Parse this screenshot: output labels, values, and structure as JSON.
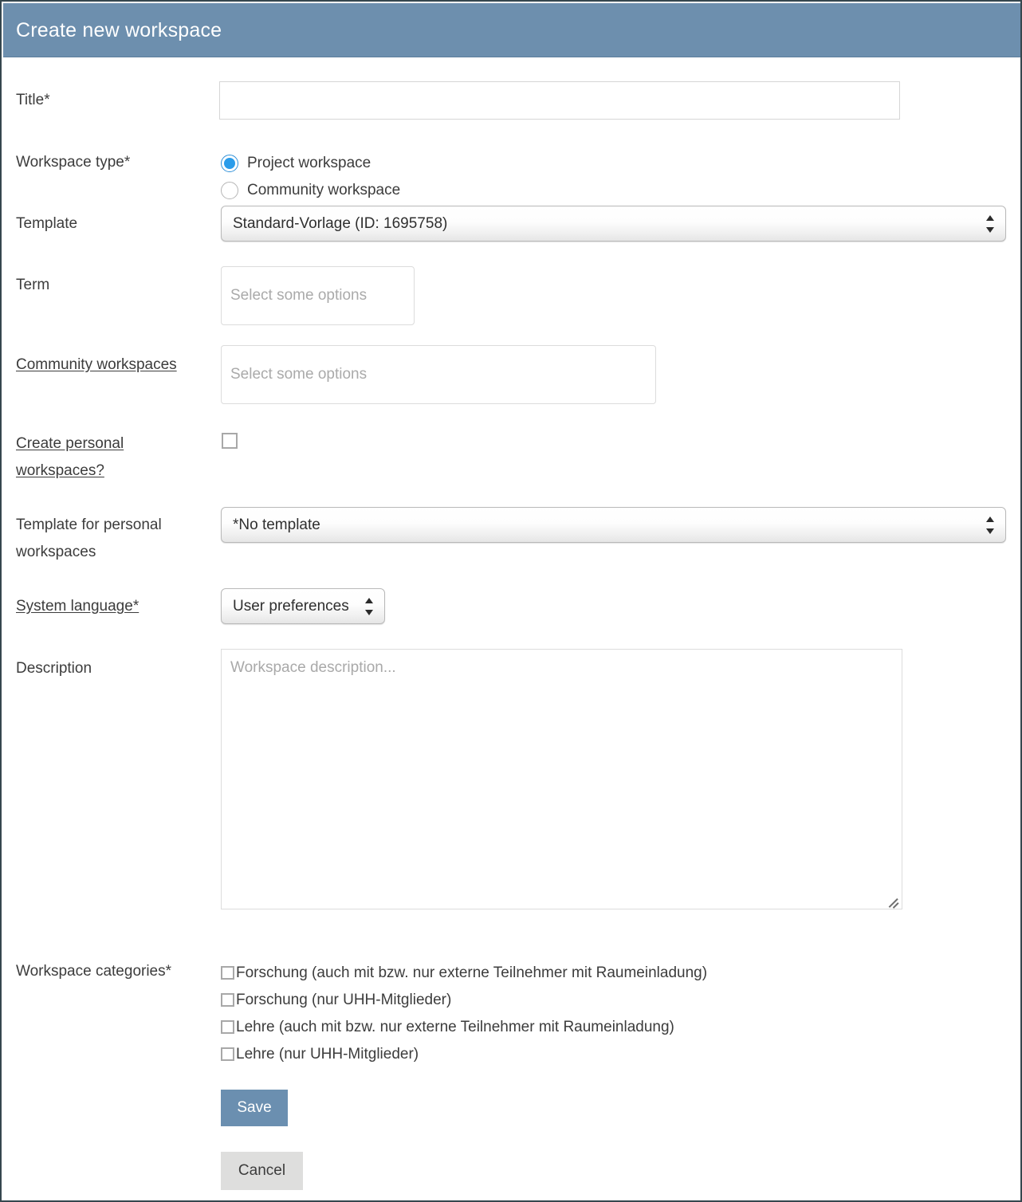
{
  "dialog": {
    "title": "Create new workspace",
    "header_color": "#6d8fae",
    "accent_color": "#6b8fb0"
  },
  "fields": {
    "title": {
      "label": "Title*",
      "value": "",
      "placeholder": ""
    },
    "workspace_type": {
      "label": "Workspace type*",
      "options": [
        {
          "label": "Project workspace",
          "selected": true
        },
        {
          "label": "Community workspace",
          "selected": false
        }
      ]
    },
    "template": {
      "label": "Template",
      "value": "Standard-Vorlage (ID: 1695758)"
    },
    "term": {
      "label": "Term",
      "placeholder": "Select some options",
      "value": ""
    },
    "community_workspaces": {
      "label": "Community workspaces",
      "placeholder": "Select some options",
      "value": ""
    },
    "create_personal_workspaces": {
      "label_line1": "Create personal",
      "label_line2": "workspaces?",
      "checked": false
    },
    "template_personal": {
      "label_line1": "Template for personal",
      "label_line2": "workspaces",
      "value": "*No template"
    },
    "system_language": {
      "label": "System language*",
      "value": "User preferences"
    },
    "description": {
      "label": "Description",
      "placeholder": "Workspace description...",
      "value": ""
    },
    "workspace_categories": {
      "label": "Workspace categories*",
      "items": [
        {
          "label": "Forschung (auch mit bzw. nur externe Teilnehmer mit Raumeinladung)",
          "checked": false
        },
        {
          "label": "Forschung (nur UHH-Mitglieder)",
          "checked": false
        },
        {
          "label": "Lehre (auch mit bzw. nur externe Teilnehmer mit Raumeinladung)",
          "checked": false
        },
        {
          "label": "Lehre (nur UHH-Mitglieder)",
          "checked": false
        }
      ]
    }
  },
  "actions": {
    "save": "Save",
    "cancel": "Cancel"
  }
}
